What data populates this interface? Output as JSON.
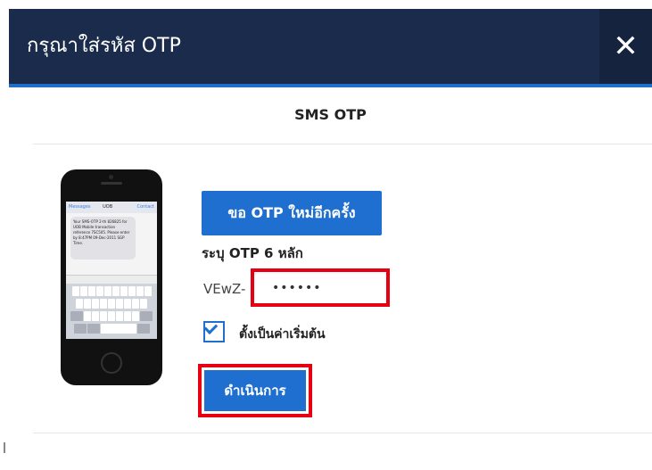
{
  "dialog": {
    "title": "กรุณาใส่รหัส OTP",
    "close_label": "✕",
    "subtitle": "SMS OTP"
  },
  "phone": {
    "header_back": "Messages",
    "header_title": "UOB",
    "header_action": "Contact",
    "sms_text": "Your SMS-OTP 2-th 826825 for UOB Mobile transaction reference 7SC505. Please enter by 8:47PM 09-Dec-2011 SGP Time."
  },
  "form": {
    "resend_button": "ขอ OTP ใหม่อีกครั้ง",
    "otp_label": "ระบุ OTP 6 หลัก",
    "otp_prefix": "VEwZ-",
    "otp_value": "••••••",
    "default_checkbox_label": "ตั้งเป็นค่าเริ่มต้น",
    "default_checked": true,
    "continue_button": "ดำเนินการ"
  },
  "colors": {
    "header_bg": "#1b2b4b",
    "accent": "#1f6fd0",
    "highlight": "#e60012"
  }
}
